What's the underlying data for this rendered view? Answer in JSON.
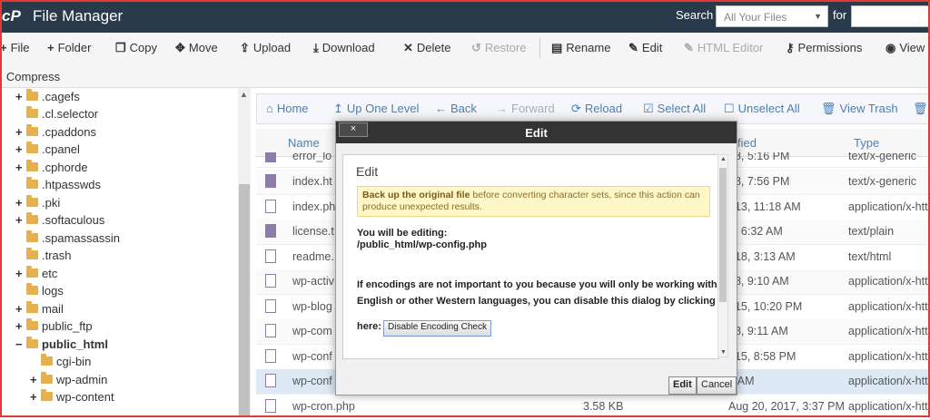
{
  "header": {
    "logo": "cP",
    "title": "File Manager",
    "search_label": "Search",
    "search_scope": "All Your Files",
    "for_label": "for",
    "search_value": ""
  },
  "toolbar": {
    "file": "File",
    "folder": "Folder",
    "copy": "Copy",
    "move": "Move",
    "upload": "Upload",
    "download": "Download",
    "delete": "Delete",
    "restore": "Restore",
    "rename": "Rename",
    "edit": "Edit",
    "html_editor": "HTML Editor",
    "permissions": "Permissions",
    "view": "View",
    "compress": "Compress"
  },
  "tree": [
    {
      "label": ".cagefs",
      "exp": "+"
    },
    {
      "label": ".cl.selector",
      "exp": ""
    },
    {
      "label": ".cpaddons",
      "exp": "+"
    },
    {
      "label": ".cpanel",
      "exp": "+"
    },
    {
      "label": ".cphorde",
      "exp": "+"
    },
    {
      "label": ".htpasswds",
      "exp": ""
    },
    {
      "label": ".pki",
      "exp": "+"
    },
    {
      "label": ".softaculous",
      "exp": "+"
    },
    {
      "label": ".spamassassin",
      "exp": ""
    },
    {
      "label": ".trash",
      "exp": ""
    },
    {
      "label": "etc",
      "exp": "+"
    },
    {
      "label": "logs",
      "exp": ""
    },
    {
      "label": "mail",
      "exp": "+"
    },
    {
      "label": "public_ftp",
      "exp": "+"
    },
    {
      "label": "public_html",
      "exp": "−"
    },
    {
      "label": "cgi-bin",
      "exp": ""
    },
    {
      "label": "wp-admin",
      "exp": "+"
    },
    {
      "label": "wp-content",
      "exp": "+"
    }
  ],
  "right_toolbar": {
    "home": "Home",
    "up": "Up One Level",
    "back": "Back",
    "forward": "Forward",
    "reload": "Reload",
    "select_all": "Select All",
    "unselect_all": "Unselect All",
    "view_trash": "View Trash"
  },
  "table": {
    "col_name": "Name",
    "col_modified": "fied",
    "col_type": "Type",
    "rows": [
      {
        "name": "error_lo",
        "size": "",
        "date": "18, 5:16 PM",
        "type": "text/x-generic",
        "icon": "text"
      },
      {
        "name": "index.ht",
        "size": "",
        "date": "18, 7:56 PM",
        "type": "text/x-generic",
        "icon": "text"
      },
      {
        "name": "index.ph",
        "size": "",
        "date": "013, 11:18 AM",
        "type": "application/x-htt",
        "icon": "code"
      },
      {
        "name": "license.t",
        "size": "",
        "date": "8, 6:32 AM",
        "type": "text/plain",
        "icon": "text"
      },
      {
        "name": "readme.",
        "size": "",
        "date": "018, 3:13 AM",
        "type": "text/html",
        "icon": "code"
      },
      {
        "name": "wp-activ",
        "size": "",
        "date": "18, 9:10 AM",
        "type": "application/x-htt",
        "icon": "code"
      },
      {
        "name": "wp-blog",
        "size": "",
        "date": "015, 10:20 PM",
        "type": "application/x-htt",
        "icon": "code"
      },
      {
        "name": "wp-com",
        "size": "",
        "date": "18, 9:11 AM",
        "type": "application/x-htt",
        "icon": "code"
      },
      {
        "name": "wp-conf",
        "size": "",
        "date": "015, 8:58 PM",
        "type": "application/x-htt",
        "icon": "code"
      },
      {
        "name": "wp-conf",
        "size": "",
        "date": "4 AM",
        "type": "application/x-htt",
        "icon": "code"
      },
      {
        "name": "wp-cron.php",
        "size": "3.58 KB",
        "date": "Aug 20, 2017, 3:37 PM",
        "type": "application/x-htt",
        "icon": "code"
      }
    ]
  },
  "modal": {
    "title": "Edit",
    "close": "×",
    "heading": "Edit",
    "warn_bold": "Back up the original file",
    "warn_rest": " before converting character sets, since this action can produce unexpected results.",
    "editing_label": "You will be editing:",
    "editing_path": "/public_html/wp-config.php",
    "enc_line1": "If encodings are not important to you because you will only be working with",
    "enc_line2": "English or other Western languages, you can disable this dialog by clicking",
    "here_label": "here:",
    "enc_button": "Disable Encoding Check",
    "edit_button": "Edit",
    "cancel_button": "Cancel"
  }
}
